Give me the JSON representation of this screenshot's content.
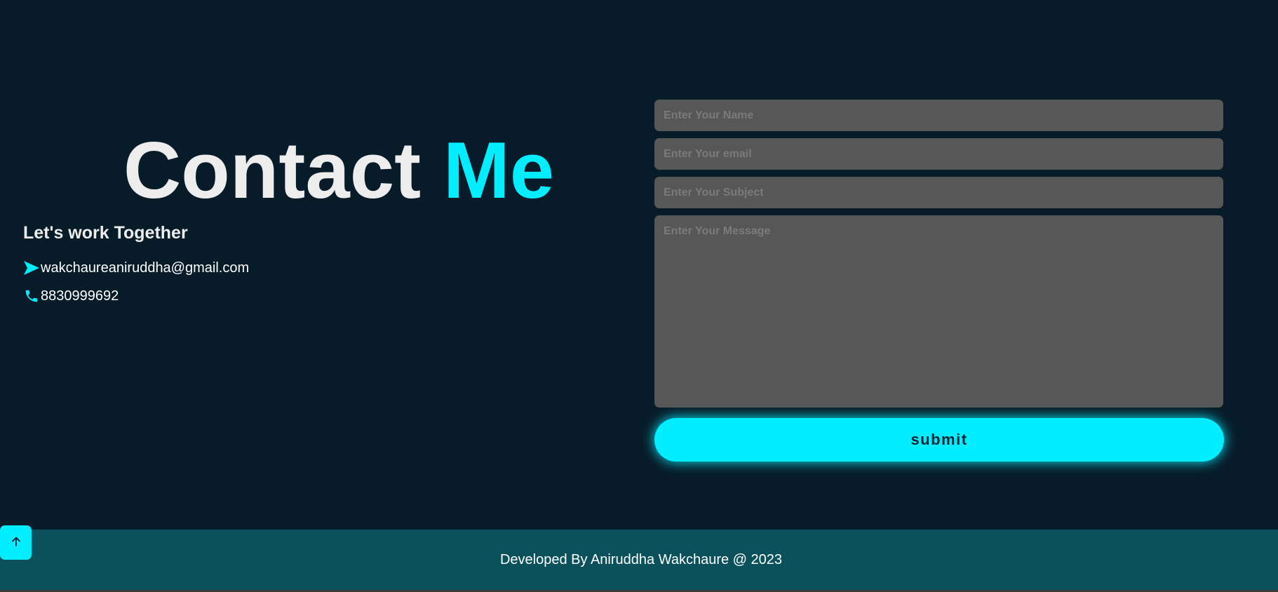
{
  "contact": {
    "heading_main": "Contact ",
    "heading_accent": "Me",
    "subheading": "Let's work Together",
    "email": "wakchaureaniruddha@gmail.com",
    "email_icon": "send-icon",
    "phone": "8830999692",
    "phone_icon": "phone-icon"
  },
  "form": {
    "name_placeholder": "Enter Your Name",
    "name_value": "",
    "email_placeholder": "Enter Your email",
    "email_value": "",
    "subject_placeholder": "Enter Your Subject",
    "subject_value": "",
    "message_placeholder": "Enter Your Message",
    "message_value": "",
    "submit_label": "submit"
  },
  "footer": {
    "text": "Developed By Aniruddha Wakchaure @ 2023",
    "scroll_top_icon": "arrow-up-icon"
  },
  "colors": {
    "background": "#081b29",
    "accent": "#00eeff",
    "field": "#575757",
    "footer": "#0a515b",
    "text": "#ededed"
  }
}
